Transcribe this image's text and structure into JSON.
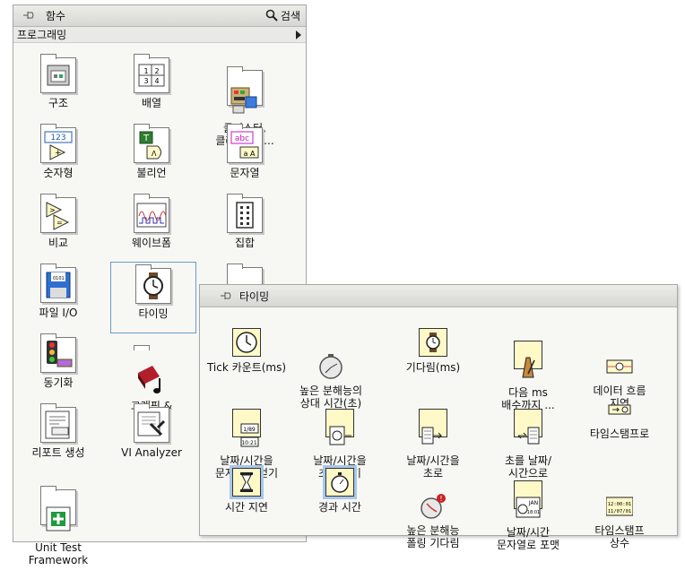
{
  "palette": {
    "title": "함수",
    "search_label": "검색",
    "category": "프로그래밍",
    "items": [
      {
        "label": "구조"
      },
      {
        "label": "배열"
      },
      {
        "label": "클러스터,\n클래스, & ..."
      },
      {
        "label": "숫자형"
      },
      {
        "label": "불리언"
      },
      {
        "label": "문자열"
      },
      {
        "label": "비교"
      },
      {
        "label": "웨이브폼"
      },
      {
        "label": "집합"
      },
      {
        "label": "파일 I/O"
      },
      {
        "label": "타이밍"
      },
      {
        "label": "동기화"
      },
      {
        "label": "그래픽 &\n사운드"
      },
      {
        "label": "리포트 생성"
      },
      {
        "label": "VI Analyzer"
      },
      {
        "label": "Unit Test\nFramework"
      }
    ]
  },
  "icon_text": {
    "numeric": "123",
    "boolean": "T",
    "string": "abc",
    "string2": "a A",
    "array": [
      "1",
      "2",
      "3",
      "4"
    ]
  },
  "timing": {
    "title": "타이밍",
    "items": [
      {
        "label": "Tick 카운트(ms)"
      },
      {
        "label": "높은 분해능의\n상대 시간(초)"
      },
      {
        "label": "기다림(ms)"
      },
      {
        "label": "다음 ms\n배수까지 ..."
      },
      {
        "label": "데이터 흐름\n지연"
      },
      {
        "label": "날짜/시간을\n문자열로 얻기"
      },
      {
        "label": "날짜/시간을\n초로 얻기"
      },
      {
        "label": "날짜/시간을\n초로"
      },
      {
        "label": "초를 날짜/\n시간으로"
      },
      {
        "label": "타임스탬프로"
      },
      {
        "label": "시간 지연"
      },
      {
        "label": "경과 시간"
      },
      {
        "label": "높은 분해능\n폴링 기다림"
      },
      {
        "label": "날짜/시간\n문자열로 포맷"
      },
      {
        "label": "타임스탬프\n상수"
      }
    ],
    "icon_text": {
      "fmt": "1/89",
      "fmt2": "10:21",
      "jan": "JAN",
      "date": "18:01",
      "ts1": "12:00:01",
      "ts2": "11/07/01"
    }
  }
}
